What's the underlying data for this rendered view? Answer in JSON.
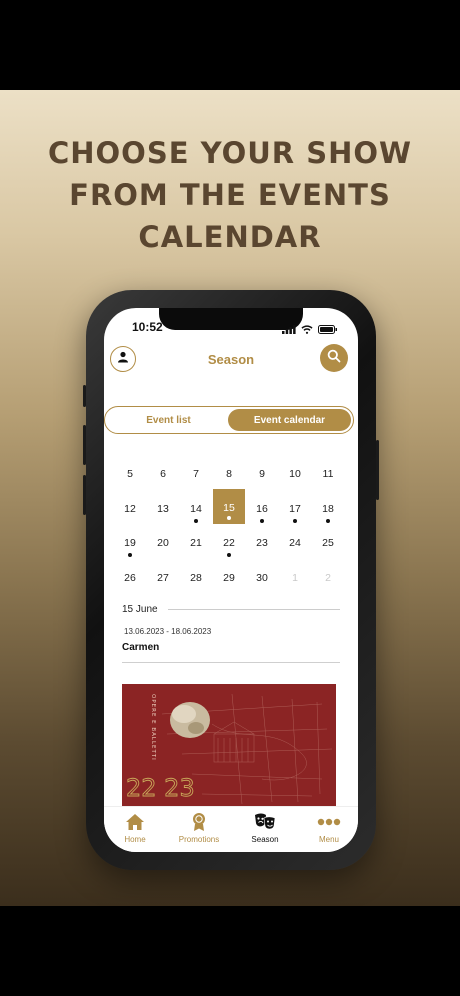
{
  "promo": {
    "headline_lines": [
      "CHOOSE YOUR SHOW",
      "FROM THE EVENTS",
      "CALENDAR"
    ]
  },
  "status_bar": {
    "time": "10:52"
  },
  "header": {
    "title": "Season",
    "left_icon": "user-icon",
    "right_icon": "search-icon"
  },
  "segmented": {
    "tabs": [
      {
        "label": "Event list",
        "active": false
      },
      {
        "label": "Event calendar",
        "active": true
      }
    ]
  },
  "calendar": {
    "weeks": [
      [
        {
          "d": "5"
        },
        {
          "d": "6"
        },
        {
          "d": "7"
        },
        {
          "d": "8"
        },
        {
          "d": "9"
        },
        {
          "d": "10"
        },
        {
          "d": "11"
        }
      ],
      [
        {
          "d": "12"
        },
        {
          "d": "13"
        },
        {
          "d": "14",
          "dot": true
        },
        {
          "d": "15",
          "dot": true,
          "selected": true
        },
        {
          "d": "16",
          "dot": true
        },
        {
          "d": "17",
          "dot": true
        },
        {
          "d": "18",
          "dot": true
        }
      ],
      [
        {
          "d": "19",
          "dot": true
        },
        {
          "d": "20"
        },
        {
          "d": "21"
        },
        {
          "d": "22",
          "dot": true
        },
        {
          "d": "23"
        },
        {
          "d": "24"
        },
        {
          "d": "25"
        }
      ],
      [
        {
          "d": "26"
        },
        {
          "d": "27"
        },
        {
          "d": "28"
        },
        {
          "d": "29"
        },
        {
          "d": "30"
        },
        {
          "d": "1",
          "muted": true
        },
        {
          "d": "2",
          "muted": true
        }
      ]
    ],
    "accent_color": "#b18d46"
  },
  "selected_date": {
    "label": "15 June",
    "event": {
      "dates": "13.06.2023 -  18.06.2023",
      "title": "Carmen"
    }
  },
  "poster": {
    "side_text": "OPERE E BALLETTI",
    "year_text": "22 23",
    "bg_color": "#8b2424"
  },
  "tabbar": {
    "items": [
      {
        "label": "Home",
        "icon": "home-icon",
        "active": false
      },
      {
        "label": "Promotions",
        "icon": "award-icon",
        "active": false
      },
      {
        "label": "Season",
        "icon": "theater-masks-icon",
        "active": true
      },
      {
        "label": "Menu",
        "icon": "more-dots-icon",
        "active": false
      }
    ]
  }
}
